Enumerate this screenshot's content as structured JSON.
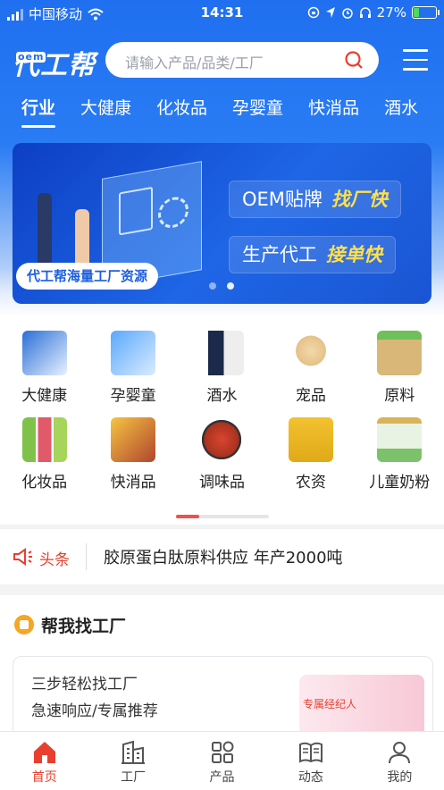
{
  "status_bar": {
    "carrier": "中国移动",
    "time": "14:31",
    "battery": "27%"
  },
  "header": {
    "logo_text": "代工帮",
    "logo_badge": "oem",
    "search_placeholder": "请输入产品/品类/工厂"
  },
  "tabs": [
    "行业",
    "大健康",
    "化妆品",
    "孕婴童",
    "快消品",
    "酒水"
  ],
  "banner": {
    "line1_a": "OEM贴牌",
    "line1_b": "找厂快",
    "line2_a": "生产代工",
    "line2_b": "接单快",
    "tag": "代工帮海量工厂资源",
    "slide_count": 2,
    "active_slide": 2
  },
  "categories": [
    {
      "label": "大健康",
      "icon": "supplement-box"
    },
    {
      "label": "孕婴童",
      "icon": "baby-product-bags"
    },
    {
      "label": "酒水",
      "icon": "liquor-bottle"
    },
    {
      "label": "宠品",
      "icon": "puppy"
    },
    {
      "label": "原料",
      "icon": "grain-jar"
    },
    {
      "label": "化妆品",
      "icon": "lipsticks"
    },
    {
      "label": "快消品",
      "icon": "snacks"
    },
    {
      "label": "调味品",
      "icon": "hotpot"
    },
    {
      "label": "农资",
      "icon": "fertilizer-bag"
    },
    {
      "label": "儿童奶粉",
      "icon": "milk-powder-can"
    }
  ],
  "news": {
    "tag": "头条",
    "text": "胶原蛋白肽原料供应 年产2000吨"
  },
  "factory_section": {
    "title": "帮我找工厂",
    "line1": "三步轻松找工厂",
    "line2": "急速响应/专属推荐",
    "agent_label": "专属经纪人"
  },
  "bottom_nav": [
    {
      "label": "首页",
      "icon": "home-icon",
      "active": true
    },
    {
      "label": "工厂",
      "icon": "factory-icon",
      "active": false
    },
    {
      "label": "产品",
      "icon": "grid-icon",
      "active": false
    },
    {
      "label": "动态",
      "icon": "book-icon",
      "active": false
    },
    {
      "label": "我的",
      "icon": "user-icon",
      "active": false
    }
  ],
  "colors": {
    "brand_blue": "#1f6ff0",
    "accent_red": "#e8402e",
    "highlight_yellow": "#ffe04a"
  }
}
